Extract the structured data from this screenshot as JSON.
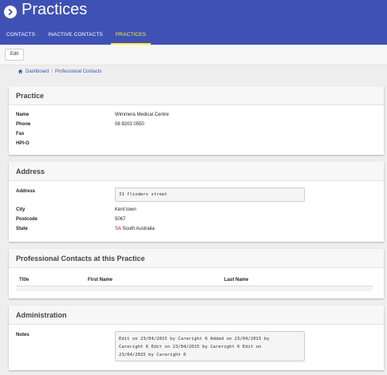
{
  "header": {
    "title": "Practices",
    "tabs": [
      {
        "label": "CONTACTS"
      },
      {
        "label": "INACTIVE CONTACTS"
      },
      {
        "label": "PRACTICES"
      }
    ],
    "active_tab": "PRACTICES",
    "colors": {
      "bar": "#3f51b5",
      "active_tab": "#ffeb3b"
    }
  },
  "toolbar": {
    "edit_label": "Edit"
  },
  "breadcrumb": {
    "home": "Dashboard",
    "current": "Professional Contacts"
  },
  "practice": {
    "heading": "Practice",
    "fields": [
      {
        "label": "Name",
        "value": "Wimmera Medical Centre"
      },
      {
        "label": "Phone",
        "value": "08 8203 0550"
      },
      {
        "label": "Fax",
        "value": ""
      },
      {
        "label": "HPI-O",
        "value": ""
      }
    ]
  },
  "address": {
    "heading": "Address",
    "address_label": "Address",
    "address_value": "31 flinders street",
    "city_label": "City",
    "city_value": "Kent town",
    "postcode_label": "Postcode",
    "postcode_value": "5067",
    "state_label": "State",
    "state_code": "SA",
    "state_value": "South Australia"
  },
  "contacts": {
    "heading": "Professional Contacts at this Practice",
    "columns": [
      "Title",
      "First Name",
      "Last Name"
    ]
  },
  "administration": {
    "heading": "Administration",
    "notes_label": "Notes",
    "notes_lines": [
      "Edit on 23/04/2015 by Careright 6 Added on 23/04/2015 by",
      "Careright 6 Edit on 23/04/2015 by Careright 6 Edit on",
      "23/04/2015 by Careright 6"
    ]
  }
}
